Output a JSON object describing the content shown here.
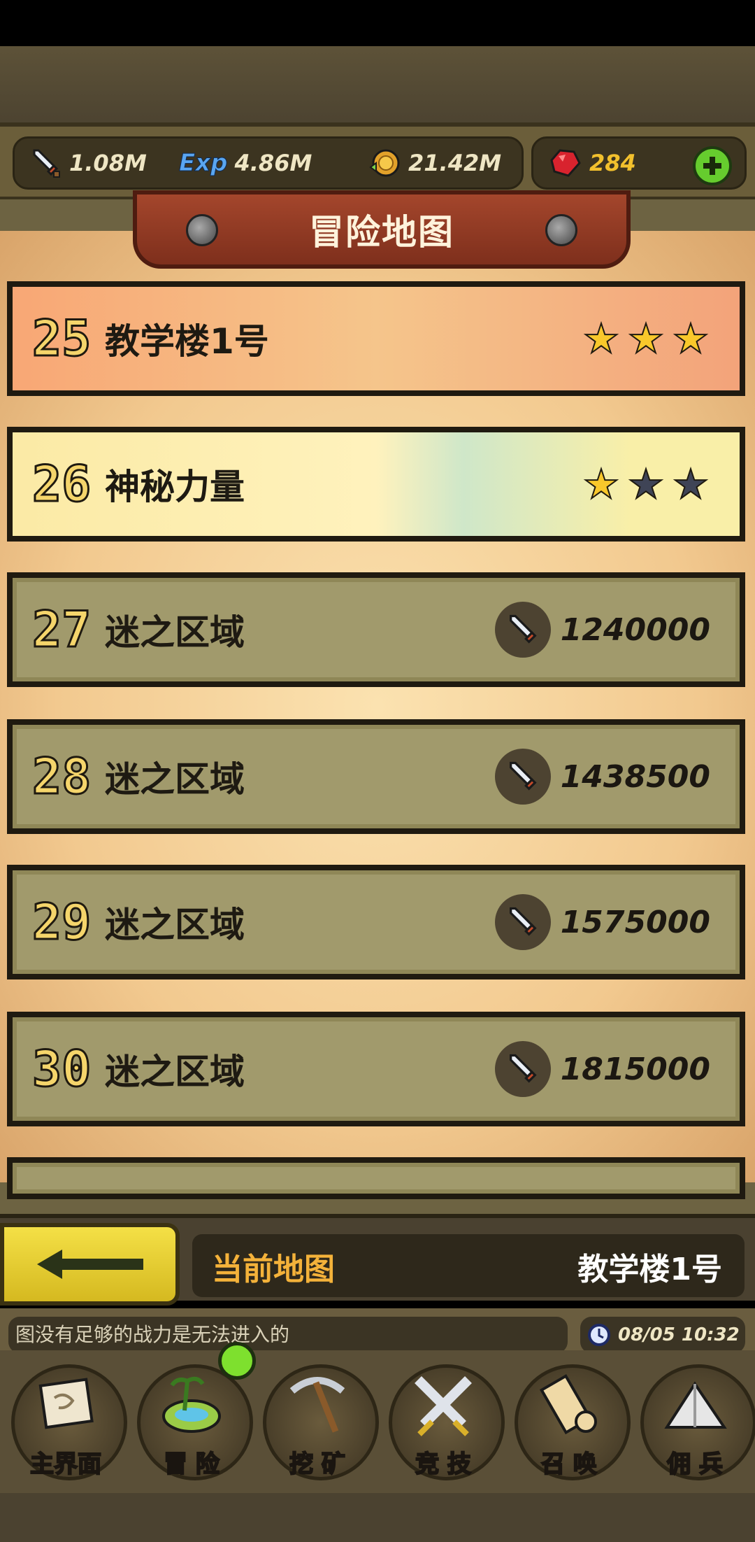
{
  "resources": {
    "power": "1.08M",
    "exp_label": "Exp",
    "exp": "4.86M",
    "coins": "21.42M",
    "gems": "284"
  },
  "header": {
    "title": "冒险地图"
  },
  "levels": [
    {
      "number": "25",
      "name": "教学楼1号",
      "stars_earned": 3,
      "stars_total": 3
    },
    {
      "number": "26",
      "name": "神秘力量",
      "stars_earned": 1,
      "stars_total": 3
    },
    {
      "number": "27",
      "name": "迷之区域",
      "required_power": "1240000"
    },
    {
      "number": "28",
      "name": "迷之区域",
      "required_power": "1438500"
    },
    {
      "number": "29",
      "name": "迷之区域",
      "required_power": "1575000"
    },
    {
      "number": "30",
      "name": "迷之区域",
      "required_power": "1815000"
    }
  ],
  "current_map": {
    "label": "当前地图",
    "value": "教学楼1号"
  },
  "ticker": {
    "text": "图没有足够的战力是无法进入的"
  },
  "clock": {
    "text": "08/05 10:32"
  },
  "nav": [
    {
      "label": "主界面"
    },
    {
      "label": "冒 险"
    },
    {
      "label": "挖 矿"
    },
    {
      "label": "竞 技"
    },
    {
      "label": "召 唤"
    },
    {
      "label": "佣 兵"
    }
  ],
  "colors": {
    "accent_gold": "#f2c02d",
    "map_label": "#f4b23a",
    "notify": "#7ee02e"
  }
}
